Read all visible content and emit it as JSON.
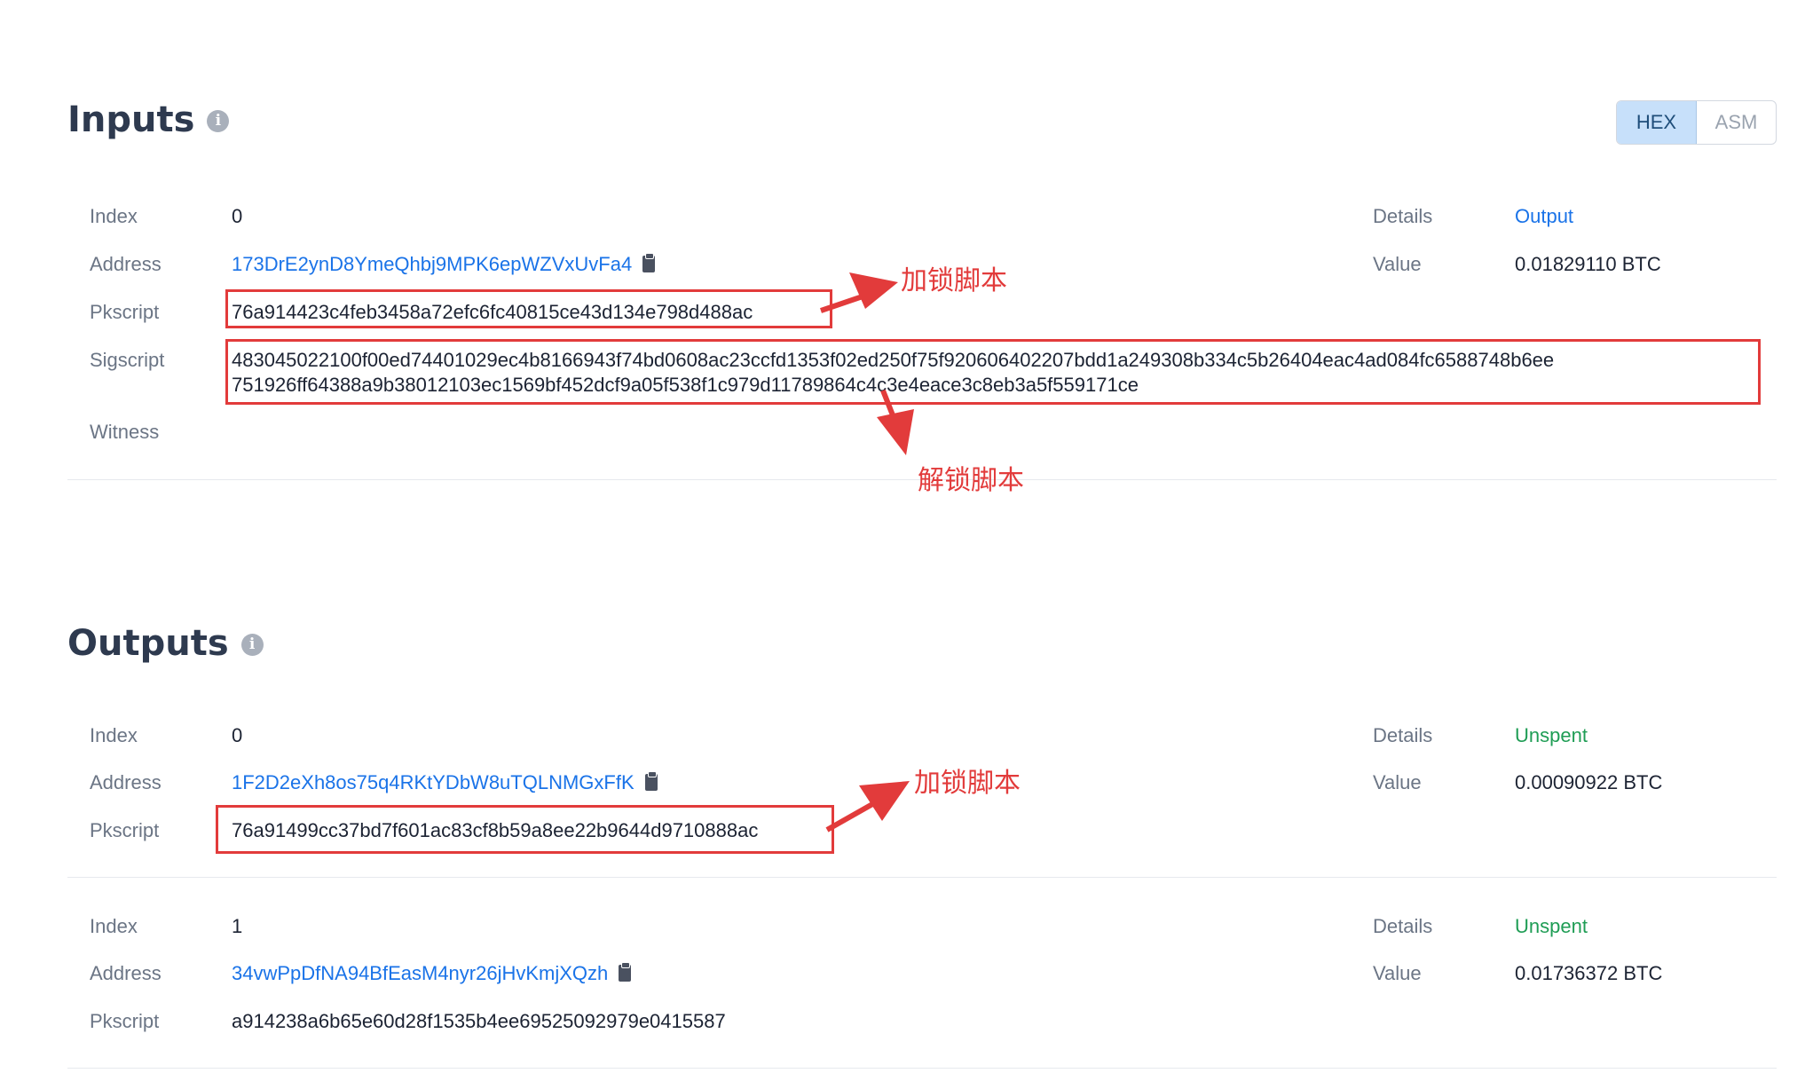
{
  "inputs": {
    "title": "Inputs",
    "info_icon": "info-icon",
    "toggle": {
      "hex": "HEX",
      "asm": "ASM",
      "active": "HEX"
    },
    "labels": {
      "index": "Index",
      "address": "Address",
      "pkscript": "Pkscript",
      "sigscript": "Sigscript",
      "witness": "Witness",
      "details": "Details",
      "value": "Value"
    },
    "items": [
      {
        "index": "0",
        "address": "173DrE2ynD8YmeQhbj9MPK6epWZVxUvFa4",
        "pkscript": "76a914423c4feb3458a72efc6fc40815ce43d134e798d488ac",
        "sigscript_line1": "483045022100f00ed74401029ec4b8166943f74bd0608ac23ccfd1353f02ed250f75f920606402207bdd1a249308b334c5b26404eac4ad084fc6588748b6ee",
        "sigscript_line2": "751926ff64388a9b38012103ec1569bf452dcf9a05f538f1c979d11789864c4c3e4eace3c8eb3a5f559171ce",
        "witness": "",
        "details": "Output",
        "value": "0.01829110 BTC"
      }
    ]
  },
  "outputs": {
    "title": "Outputs",
    "info_icon": "info-icon",
    "labels": {
      "index": "Index",
      "address": "Address",
      "pkscript": "Pkscript",
      "details": "Details",
      "value": "Value"
    },
    "items": [
      {
        "index": "0",
        "address": "1F2D2eXh8os75q4RKtYDbW8uTQLNMGxFfK",
        "pkscript": "76a91499cc37bd7f601ac83cf8b59a8ee22b9644d9710888ac",
        "details": "Unspent",
        "value": "0.00090922 BTC"
      },
      {
        "index": "1",
        "address": "34vwPpDfNA94BfEasM4nyr26jHvKmjXQzh",
        "pkscript": "a914238a6b65e60d28f1535b4ee69525092979e0415587",
        "details": "Unspent",
        "value": "0.01736372 BTC"
      }
    ]
  },
  "annotations": {
    "lock_script": "加锁脚本",
    "unlock_script": "解锁脚本",
    "lock_script_2": "加锁脚本"
  },
  "colors": {
    "link": "#1a73e8",
    "unspent": "#1f9d55",
    "annotation": "#e23b3b",
    "toggle_active_bg": "#c7e0fa"
  }
}
